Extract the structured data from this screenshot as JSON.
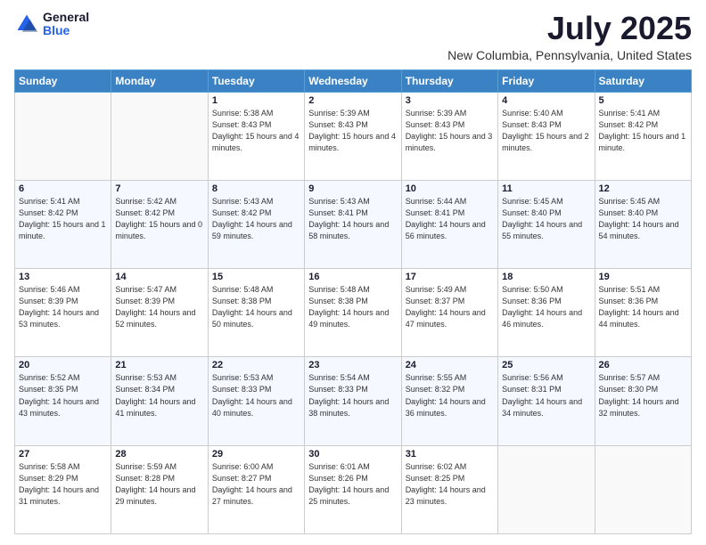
{
  "logo": {
    "general": "General",
    "blue": "Blue"
  },
  "title": "July 2025",
  "location": "New Columbia, Pennsylvania, United States",
  "days_of_week": [
    "Sunday",
    "Monday",
    "Tuesday",
    "Wednesday",
    "Thursday",
    "Friday",
    "Saturday"
  ],
  "weeks": [
    [
      {
        "day": "",
        "info": ""
      },
      {
        "day": "",
        "info": ""
      },
      {
        "day": "1",
        "info": "Sunrise: 5:38 AM\nSunset: 8:43 PM\nDaylight: 15 hours\nand 4 minutes."
      },
      {
        "day": "2",
        "info": "Sunrise: 5:39 AM\nSunset: 8:43 PM\nDaylight: 15 hours\nand 4 minutes."
      },
      {
        "day": "3",
        "info": "Sunrise: 5:39 AM\nSunset: 8:43 PM\nDaylight: 15 hours\nand 3 minutes."
      },
      {
        "day": "4",
        "info": "Sunrise: 5:40 AM\nSunset: 8:43 PM\nDaylight: 15 hours\nand 2 minutes."
      },
      {
        "day": "5",
        "info": "Sunrise: 5:41 AM\nSunset: 8:42 PM\nDaylight: 15 hours\nand 1 minute."
      }
    ],
    [
      {
        "day": "6",
        "info": "Sunrise: 5:41 AM\nSunset: 8:42 PM\nDaylight: 15 hours\nand 1 minute."
      },
      {
        "day": "7",
        "info": "Sunrise: 5:42 AM\nSunset: 8:42 PM\nDaylight: 15 hours\nand 0 minutes."
      },
      {
        "day": "8",
        "info": "Sunrise: 5:43 AM\nSunset: 8:42 PM\nDaylight: 14 hours\nand 59 minutes."
      },
      {
        "day": "9",
        "info": "Sunrise: 5:43 AM\nSunset: 8:41 PM\nDaylight: 14 hours\nand 58 minutes."
      },
      {
        "day": "10",
        "info": "Sunrise: 5:44 AM\nSunset: 8:41 PM\nDaylight: 14 hours\nand 56 minutes."
      },
      {
        "day": "11",
        "info": "Sunrise: 5:45 AM\nSunset: 8:40 PM\nDaylight: 14 hours\nand 55 minutes."
      },
      {
        "day": "12",
        "info": "Sunrise: 5:45 AM\nSunset: 8:40 PM\nDaylight: 14 hours\nand 54 minutes."
      }
    ],
    [
      {
        "day": "13",
        "info": "Sunrise: 5:46 AM\nSunset: 8:39 PM\nDaylight: 14 hours\nand 53 minutes."
      },
      {
        "day": "14",
        "info": "Sunrise: 5:47 AM\nSunset: 8:39 PM\nDaylight: 14 hours\nand 52 minutes."
      },
      {
        "day": "15",
        "info": "Sunrise: 5:48 AM\nSunset: 8:38 PM\nDaylight: 14 hours\nand 50 minutes."
      },
      {
        "day": "16",
        "info": "Sunrise: 5:48 AM\nSunset: 8:38 PM\nDaylight: 14 hours\nand 49 minutes."
      },
      {
        "day": "17",
        "info": "Sunrise: 5:49 AM\nSunset: 8:37 PM\nDaylight: 14 hours\nand 47 minutes."
      },
      {
        "day": "18",
        "info": "Sunrise: 5:50 AM\nSunset: 8:36 PM\nDaylight: 14 hours\nand 46 minutes."
      },
      {
        "day": "19",
        "info": "Sunrise: 5:51 AM\nSunset: 8:36 PM\nDaylight: 14 hours\nand 44 minutes."
      }
    ],
    [
      {
        "day": "20",
        "info": "Sunrise: 5:52 AM\nSunset: 8:35 PM\nDaylight: 14 hours\nand 43 minutes."
      },
      {
        "day": "21",
        "info": "Sunrise: 5:53 AM\nSunset: 8:34 PM\nDaylight: 14 hours\nand 41 minutes."
      },
      {
        "day": "22",
        "info": "Sunrise: 5:53 AM\nSunset: 8:33 PM\nDaylight: 14 hours\nand 40 minutes."
      },
      {
        "day": "23",
        "info": "Sunrise: 5:54 AM\nSunset: 8:33 PM\nDaylight: 14 hours\nand 38 minutes."
      },
      {
        "day": "24",
        "info": "Sunrise: 5:55 AM\nSunset: 8:32 PM\nDaylight: 14 hours\nand 36 minutes."
      },
      {
        "day": "25",
        "info": "Sunrise: 5:56 AM\nSunset: 8:31 PM\nDaylight: 14 hours\nand 34 minutes."
      },
      {
        "day": "26",
        "info": "Sunrise: 5:57 AM\nSunset: 8:30 PM\nDaylight: 14 hours\nand 32 minutes."
      }
    ],
    [
      {
        "day": "27",
        "info": "Sunrise: 5:58 AM\nSunset: 8:29 PM\nDaylight: 14 hours\nand 31 minutes."
      },
      {
        "day": "28",
        "info": "Sunrise: 5:59 AM\nSunset: 8:28 PM\nDaylight: 14 hours\nand 29 minutes."
      },
      {
        "day": "29",
        "info": "Sunrise: 6:00 AM\nSunset: 8:27 PM\nDaylight: 14 hours\nand 27 minutes."
      },
      {
        "day": "30",
        "info": "Sunrise: 6:01 AM\nSunset: 8:26 PM\nDaylight: 14 hours\nand 25 minutes."
      },
      {
        "day": "31",
        "info": "Sunrise: 6:02 AM\nSunset: 8:25 PM\nDaylight: 14 hours\nand 23 minutes."
      },
      {
        "day": "",
        "info": ""
      },
      {
        "day": "",
        "info": ""
      }
    ]
  ]
}
